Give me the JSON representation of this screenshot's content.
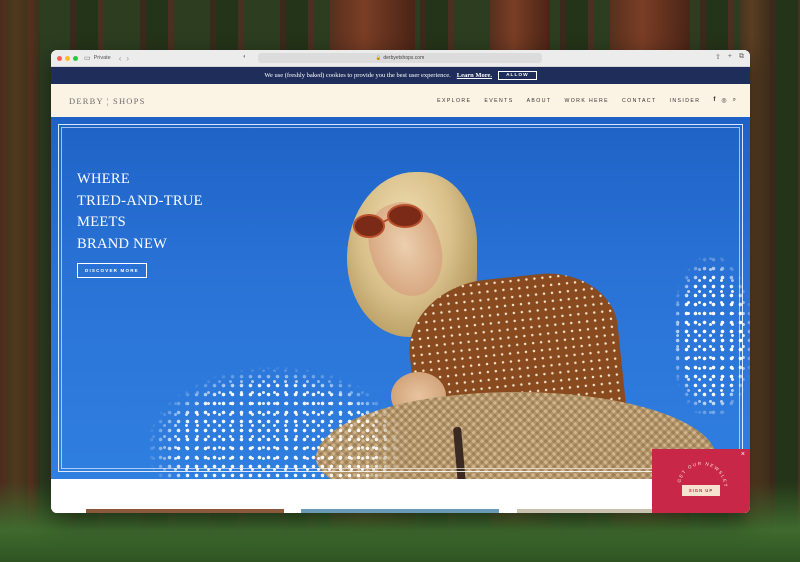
{
  "browser": {
    "mode_label": "Private",
    "url": "derbyetshops.com"
  },
  "cookie_bar": {
    "message": "We use (freshly baked) cookies to provide you the best user experience.",
    "link_text": "Learn More.",
    "button_label": "ALLOW"
  },
  "header": {
    "logo": "DERBY ¦ SHOPS",
    "nav": [
      {
        "label": "EXPLORE"
      },
      {
        "label": "EVENTS"
      },
      {
        "label": "ABOUT"
      },
      {
        "label": "WORK HERE"
      },
      {
        "label": "CONTACT"
      },
      {
        "label": "INSIDER"
      }
    ],
    "icons": [
      "facebook-icon",
      "instagram-icon",
      "search-icon"
    ]
  },
  "hero": {
    "headline_lines": [
      "WHERE",
      "TRIED-AND-TRUE",
      "MEETS",
      "BRAND NEW"
    ],
    "cta_label": "DISCOVER MORE"
  },
  "newsletter": {
    "ring_text": "GET OUR NEWSLETTER",
    "button_label": "SIGN UP",
    "accent": "#c92747"
  },
  "colors": {
    "cookie_bar": "#1e2d5a",
    "header_bg": "#fbf3e4",
    "hero_sky": "#2a73d6"
  }
}
